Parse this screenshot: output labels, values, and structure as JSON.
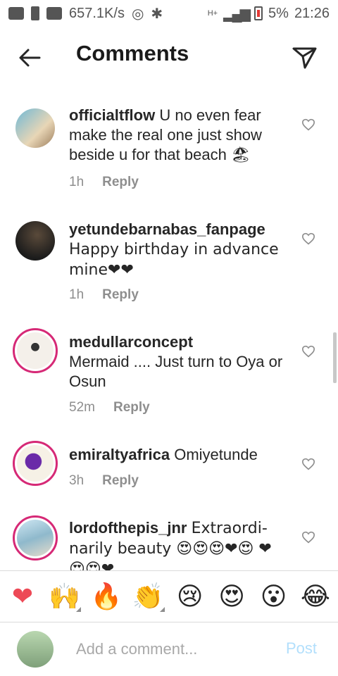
{
  "status_bar": {
    "speed": "657.1K/s",
    "network": "H+",
    "battery": "5%",
    "time": "21:26"
  },
  "header": {
    "title": "Comments"
  },
  "comments": [
    {
      "user": "officialtflow",
      "text": "U no even fear make the real one just show beside u for that beach 🏖",
      "time": "1h",
      "reply": "Reply"
    },
    {
      "user": "yetundebarnabas_fanpage",
      "text": "Happy birthday in advance mine❤❤",
      "time": "1h",
      "reply": "Reply"
    },
    {
      "user": "medullarconcept",
      "text": "Mermaid .... Just turn to Oya or Osun",
      "time": "52m",
      "reply": "Reply"
    },
    {
      "user": "emiraltyafrica",
      "text": "Omiyetunde",
      "time": "3h",
      "reply": "Reply"
    },
    {
      "user": "lordofthepis_jnr",
      "text": "Extraordi-narily beauty 😍😍😍❤😍 ❤😍😍❤",
      "time": "",
      "reply": ""
    }
  ],
  "emoji_bar": [
    {
      "glyph": "❤",
      "name": "heart"
    },
    {
      "glyph": "🙌",
      "name": "raising-hands"
    },
    {
      "glyph": "🔥",
      "name": "fire"
    },
    {
      "glyph": "👏",
      "name": "clapping-hands"
    },
    {
      "glyph": "😢",
      "name": "crying-face"
    },
    {
      "glyph": "😍",
      "name": "heart-eyes"
    },
    {
      "glyph": "😮",
      "name": "surprised-face"
    },
    {
      "glyph": "😂",
      "name": "laughing-face"
    }
  ],
  "composer": {
    "placeholder": "Add a comment...",
    "post_label": "Post"
  },
  "colors": {
    "accent_post": "#b2dffc",
    "heart_red": "#ed4956",
    "muted_text": "#8e8e8e"
  }
}
